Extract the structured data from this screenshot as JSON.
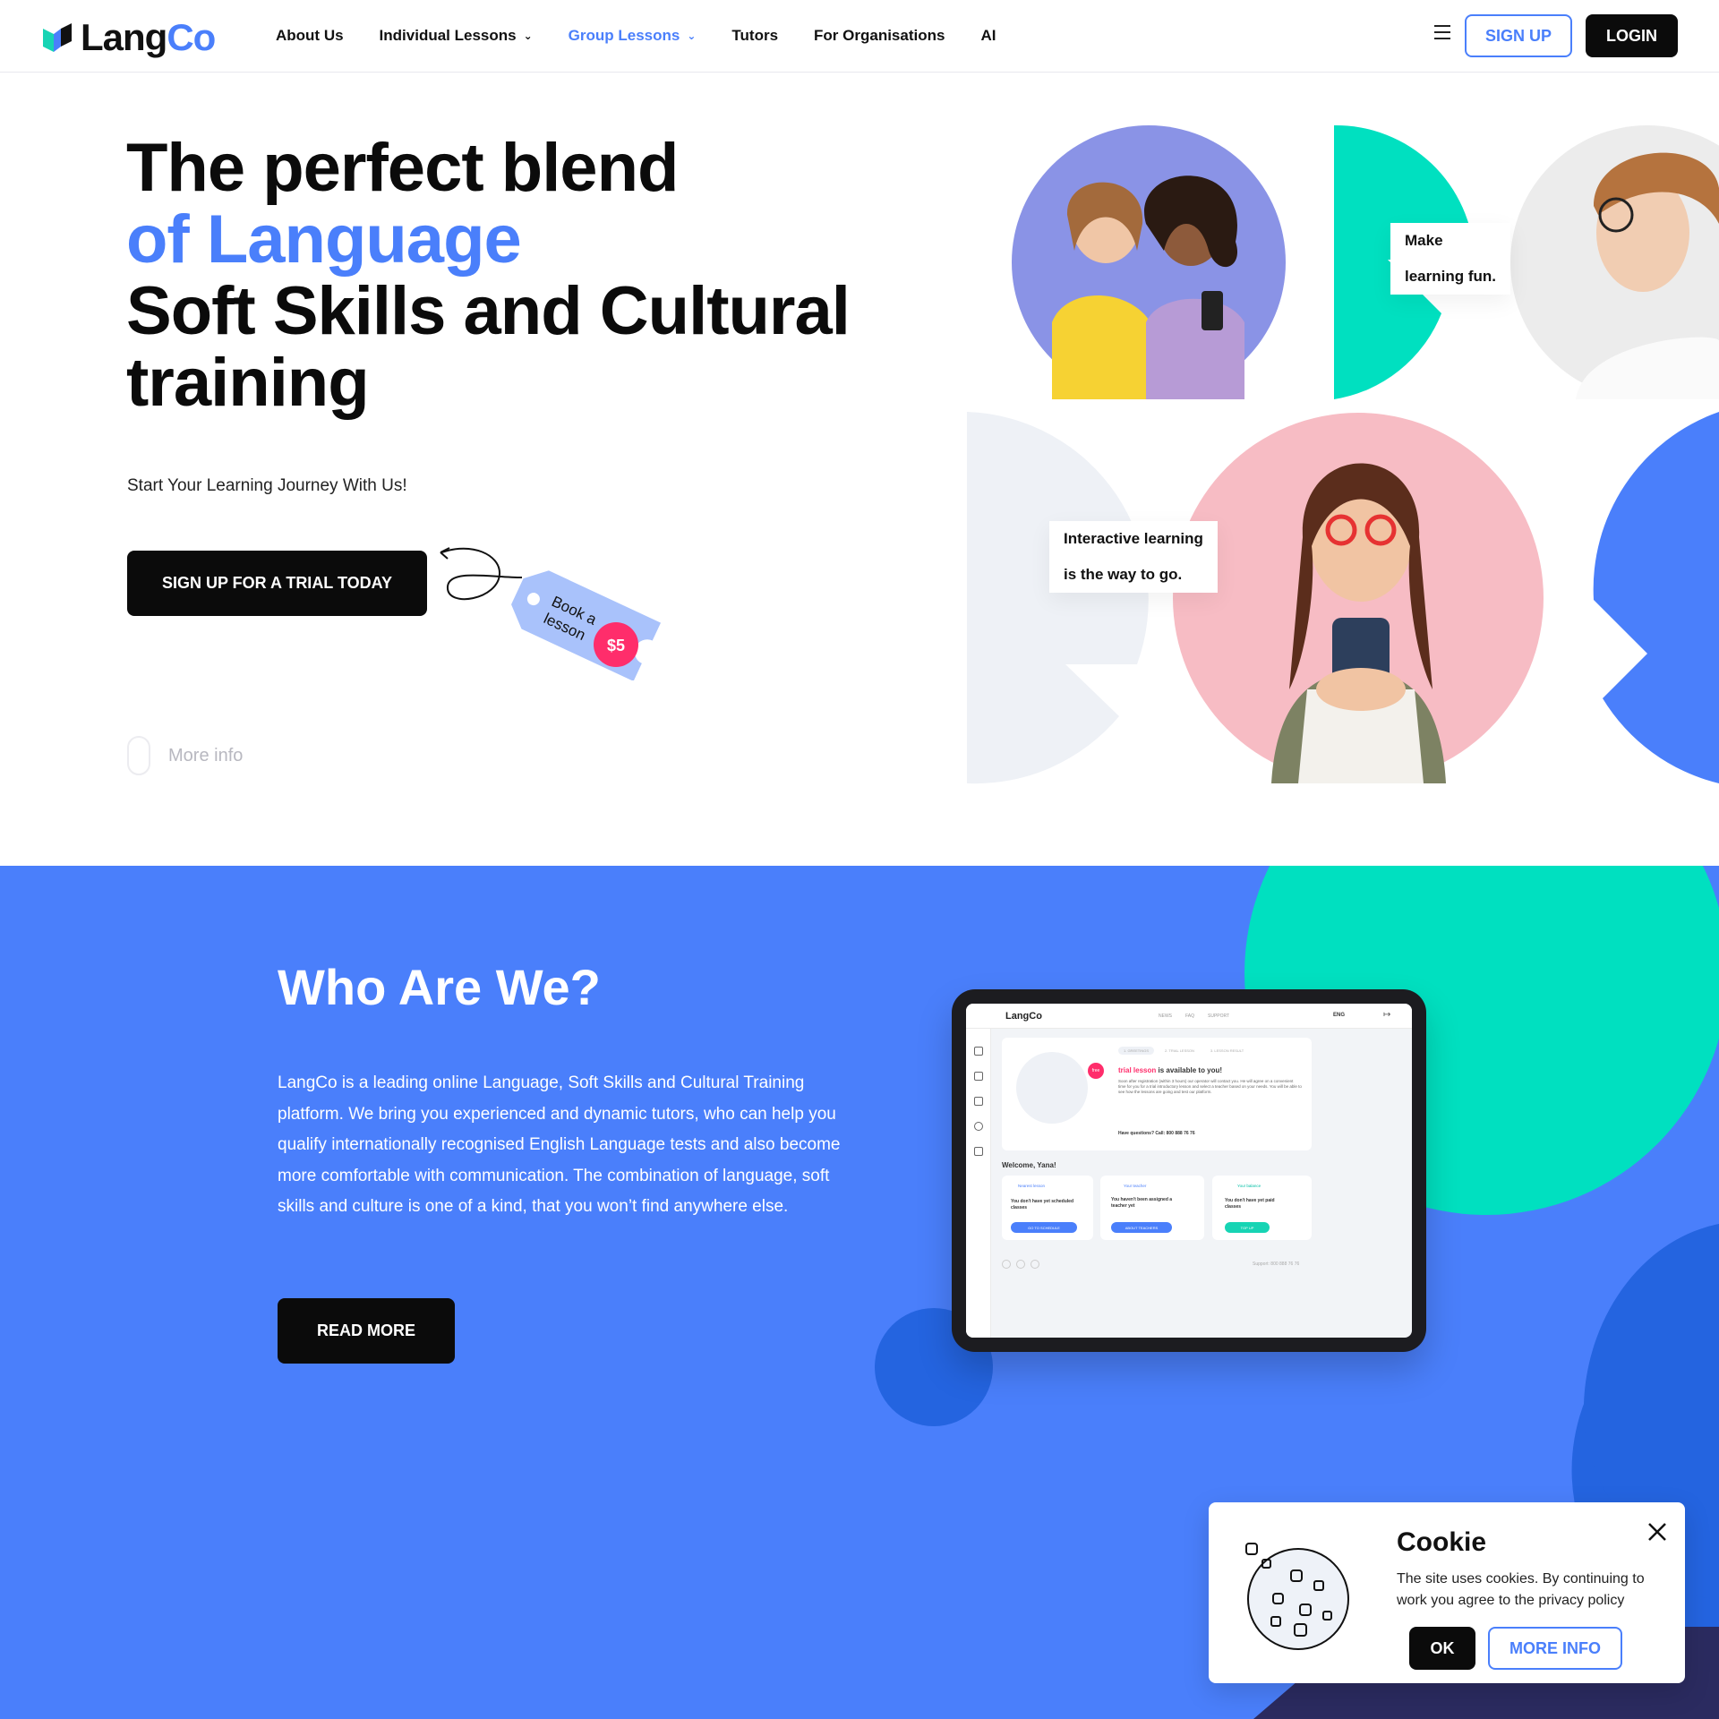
{
  "header": {
    "logo_lang": "Lang",
    "logo_co": "Co",
    "nav": [
      {
        "label": "About Us"
      },
      {
        "label": "Individual Lessons",
        "dropdown": true
      },
      {
        "label": "Group Lessons",
        "dropdown": true,
        "active": true
      },
      {
        "label": "Tutors"
      },
      {
        "label": "For Organisations"
      },
      {
        "label": "AI"
      }
    ],
    "signup_label": "SIGN UP",
    "login_label": "LOGIN"
  },
  "hero": {
    "title_line1": "The perfect blend",
    "title_line2": "of Language",
    "title_line3": "Soft Skills and Cultural",
    "title_line4": "training",
    "subtitle": "Start Your Learning Journey With Us!",
    "cta_label": "SIGN UP FOR A TRIAL TODAY",
    "tag_line1": "Book a",
    "tag_line2": "lesson",
    "tag_price": "$5",
    "more_info": "More info",
    "bubble1_line1": "Make",
    "bubble1_line2": "learning fun.",
    "bubble2_line1": "Interactive learning",
    "bubble2_line2": "is the way to go."
  },
  "who": {
    "title": "Who Are We?",
    "text": "LangCo is a leading online Language, Soft Skills and Cultural Training platform. We bring you experienced and dynamic tutors, who can help you qualify internationally recognised English Language tests and also become more comfortable with communication. The combination of language, soft skills and culture is one of a kind, that you won’t find anywhere else.",
    "read_more": "READ MORE"
  },
  "tablet": {
    "logo": "LangCo",
    "nav_items": [
      "NEWS",
      "FAQ",
      "SUPPORT"
    ],
    "lang": "ENG",
    "steps": [
      "1. GREETINGS",
      "2. TRIAL LESSON",
      "3. LESSON RESULT"
    ],
    "free_badge": "free",
    "trial_highlight": "trial lesson",
    "trial_rest": "is available to you!",
    "trial_desc": "Soon after registration (within 3 hours) our operator will contact you. He will agree on a convenient time for you for a trial introductory lesson and select a teacher based on your needs. You will be able to see how the lessons are going and test our platform.",
    "questions": "Have questions? Call: 800 888 76 76",
    "welcome": "Welcome, Yana!",
    "cards": [
      {
        "head": "Nearest lesson",
        "body": "You don't have yet scheduled classes",
        "btn": "GO TO SCHEDULE"
      },
      {
        "head": "Your teacher",
        "body": "You haven't been assigned a teacher yet",
        "btn": "ABOUT TEACHERS"
      },
      {
        "head": "Your balance",
        "body": "You don't have yet paid classes",
        "btn": "TOP UP"
      }
    ],
    "support": "Support: 800 888 76 76"
  },
  "cookie": {
    "title": "Cookie",
    "text": "The site uses cookies. By continuing to work you agree to the privacy policy",
    "ok": "OK",
    "more": "MORE INFO"
  },
  "colors": {
    "accent": "#4a7ffb",
    "teal": "#00e0c0",
    "pink": "#ff2d6b",
    "dark": "#0b0b0b"
  }
}
